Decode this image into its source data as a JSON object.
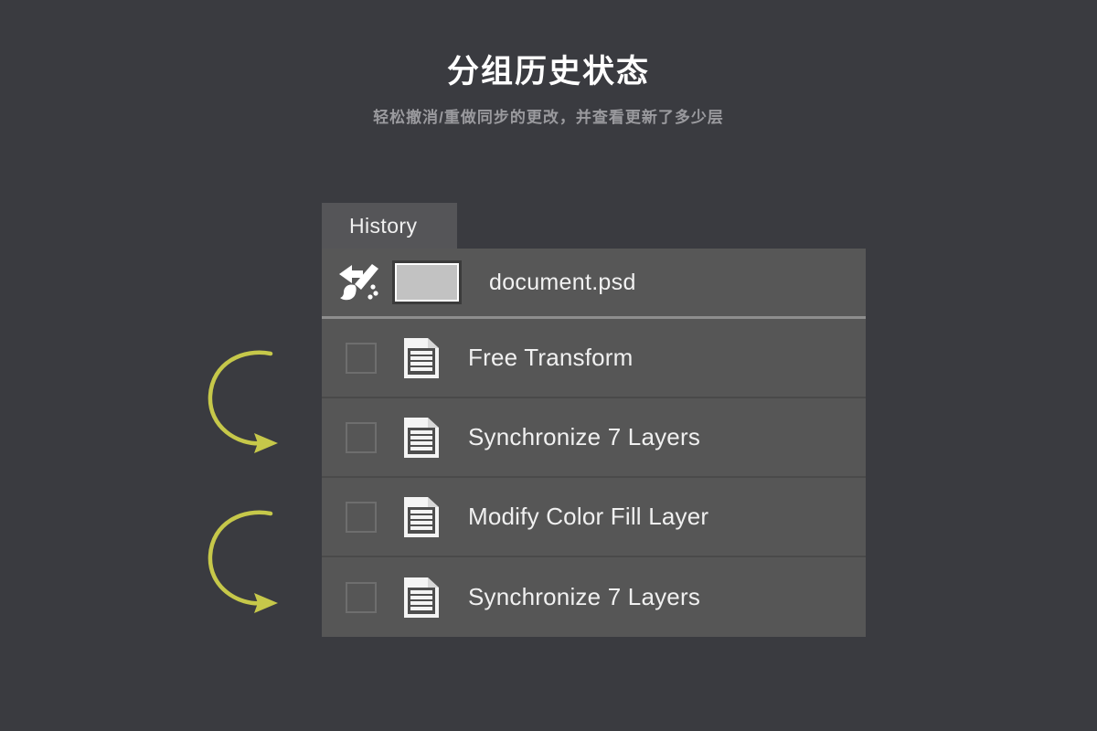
{
  "header": {
    "title": "分组历史状态",
    "subtitle": "轻松撤消/重做同步的更改，并查看更新了多少层"
  },
  "panel": {
    "tab_label": "History",
    "document": {
      "brush_icon": "history-brush-icon",
      "thumbnail": "document-thumbnail",
      "name": "document.psd"
    },
    "states": [
      {
        "label": "Free Transform",
        "icon": "document-icon",
        "checked": false
      },
      {
        "label": "Synchronize 7 Layers",
        "icon": "document-icon",
        "checked": false
      },
      {
        "label": "Modify Color Fill Layer",
        "icon": "document-icon",
        "checked": false
      },
      {
        "label": "Synchronize 7 Layers",
        "icon": "document-icon",
        "checked": false
      }
    ]
  },
  "annotations": [
    {
      "name": "curved-arrow-icon",
      "points_to": "Synchronize 7 Layers"
    },
    {
      "name": "curved-arrow-icon",
      "points_to": "Synchronize 7 Layers"
    }
  ],
  "colors": {
    "background": "#3a3b40",
    "panel": "#575757",
    "tab": "#555558",
    "text": "#f0f0f0",
    "subtitle": "#9a9a9e",
    "arrow": "#c6c84a",
    "thumbnail_fill": "#c2c2c2"
  }
}
